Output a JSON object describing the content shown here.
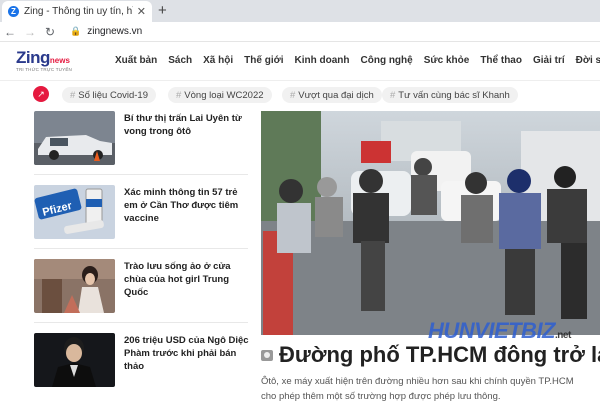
{
  "browser": {
    "tab_title": "Zing - Thông tin uy tín, hình ảnh",
    "favicon_letter": "Z",
    "url": "zingnews.vn"
  },
  "site": {
    "logo_main": "Zing",
    "logo_news": "news",
    "logo_tagline": "TRI THỨC TRỰC TUYẾN",
    "nav": [
      "Xuất bản",
      "Sách",
      "Xã hội",
      "Thế giới",
      "Kinh doanh",
      "Công nghệ",
      "Sức khỏe",
      "Thể thao",
      "Giải trí",
      "Đời sống"
    ]
  },
  "trending": [
    "Số liệu Covid-19",
    "Vòng loại WC2022",
    "Vượt qua đại dịch",
    "Tư vấn cùng bác sĩ Khanh"
  ],
  "articles": [
    {
      "title": "Bí thư thị trấn Lai Uyên từ vong trong ôtô"
    },
    {
      "title": "Xác minh thông tin 57 trẻ em ở Cần Thơ được tiêm vaccine",
      "thumb_text": "Pfizer"
    },
    {
      "title": "Trào lưu sống ảo ở cửa chùa của hot girl Trung Quốc"
    },
    {
      "title": "206 triệu USD của Ngô Diệc Phàm trước khi phải bán thảo"
    }
  ],
  "hero": {
    "headline": "Đường phố TP.HCM đông trở lại",
    "sapo": "Ôtô, xe máy xuất hiện trên đường nhiều hơn sau khi chính quyền TP.HCM cho phép thêm một số trường hợp được phép lưu thông."
  },
  "watermark": {
    "main": "HUNVIETBIZ",
    "suffix": ".net"
  },
  "colors": {
    "brand_red": "#e5193f",
    "brand_blue": "#2a3a8c"
  }
}
